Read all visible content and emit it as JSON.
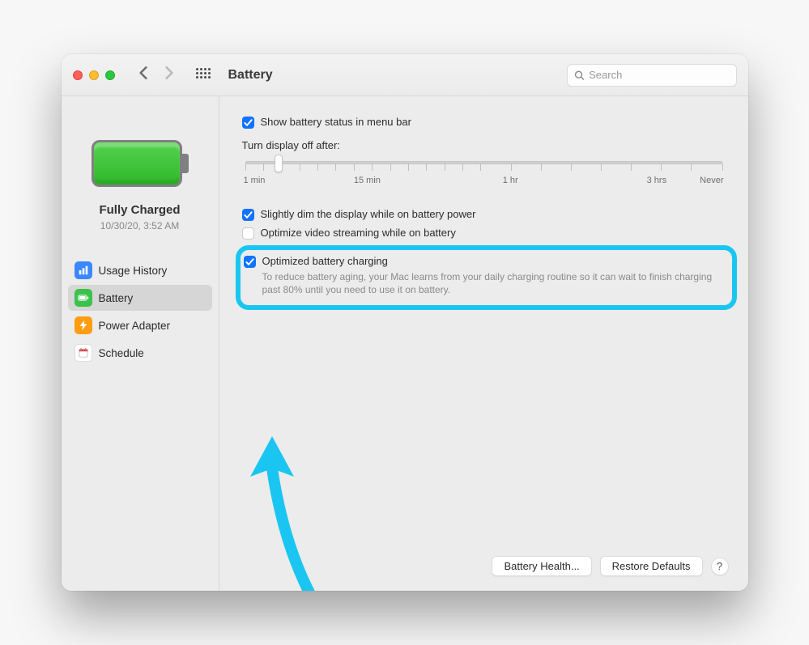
{
  "window": {
    "title": "Battery",
    "search_placeholder": "Search"
  },
  "sidebar": {
    "status_label": "Fully Charged",
    "status_date": "10/30/20, 3:52 AM",
    "items": [
      {
        "label": "Usage History"
      },
      {
        "label": "Battery"
      },
      {
        "label": "Power Adapter"
      },
      {
        "label": "Schedule"
      }
    ]
  },
  "main": {
    "show_status_label": "Show battery status in menu bar",
    "turn_display_label": "Turn display off after:",
    "slider_ticks": {
      "t1": "1 min",
      "t15": "15 min",
      "t60": "1 hr",
      "t180": "3 hrs",
      "never": "Never"
    },
    "dim_label": "Slightly dim the display while on battery power",
    "optimize_video_label": "Optimize video streaming while on battery",
    "optimized_charging_label": "Optimized battery charging",
    "optimized_charging_desc": "To reduce battery aging, your Mac learns from your daily charging routine so it can wait to finish charging past 80% until you need to use it on battery."
  },
  "footer": {
    "battery_health": "Battery Health...",
    "restore_defaults": "Restore Defaults",
    "help": "?"
  }
}
